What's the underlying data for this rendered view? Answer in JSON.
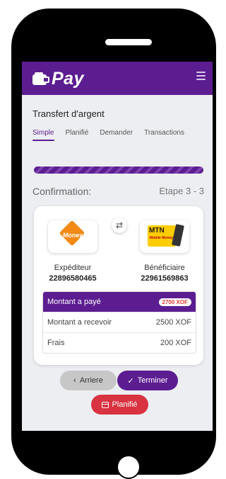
{
  "app": {
    "name": "Pay",
    "accent": "#5c1d91",
    "danger": "#d93240"
  },
  "header": {
    "title": "Transfert d'argent"
  },
  "tabs": [
    {
      "label": "Simple",
      "active": true
    },
    {
      "label": "Planifié"
    },
    {
      "label": "Demander"
    },
    {
      "label": "Transactions"
    }
  ],
  "progress": {
    "fraction": 1.0
  },
  "confirmation": {
    "label": "Confirmation:",
    "step": "Etape 3 - 3"
  },
  "sender": {
    "role": "Expéditeur",
    "number": "22896580465",
    "logo": "moov-money-logo",
    "logo_text": "Money"
  },
  "receiver": {
    "role": "Bénéficiaire",
    "number": "22961569863",
    "logo": "mtn-mobile-money-logo",
    "logo_text": "MTN",
    "logo_sub": "Mobile Money"
  },
  "summary": [
    {
      "label": "Montant a payé",
      "value": "2700 XOF"
    },
    {
      "label": "Montant a recevoir",
      "value": "2500 XOF"
    },
    {
      "label": "Frais",
      "value": "200 XOF"
    }
  ],
  "buttons": {
    "back": "Arriere",
    "finish": "Terminer",
    "plan": "Planifié"
  },
  "icons": {
    "swap": "⇄",
    "back": "‹",
    "check": "✓"
  }
}
